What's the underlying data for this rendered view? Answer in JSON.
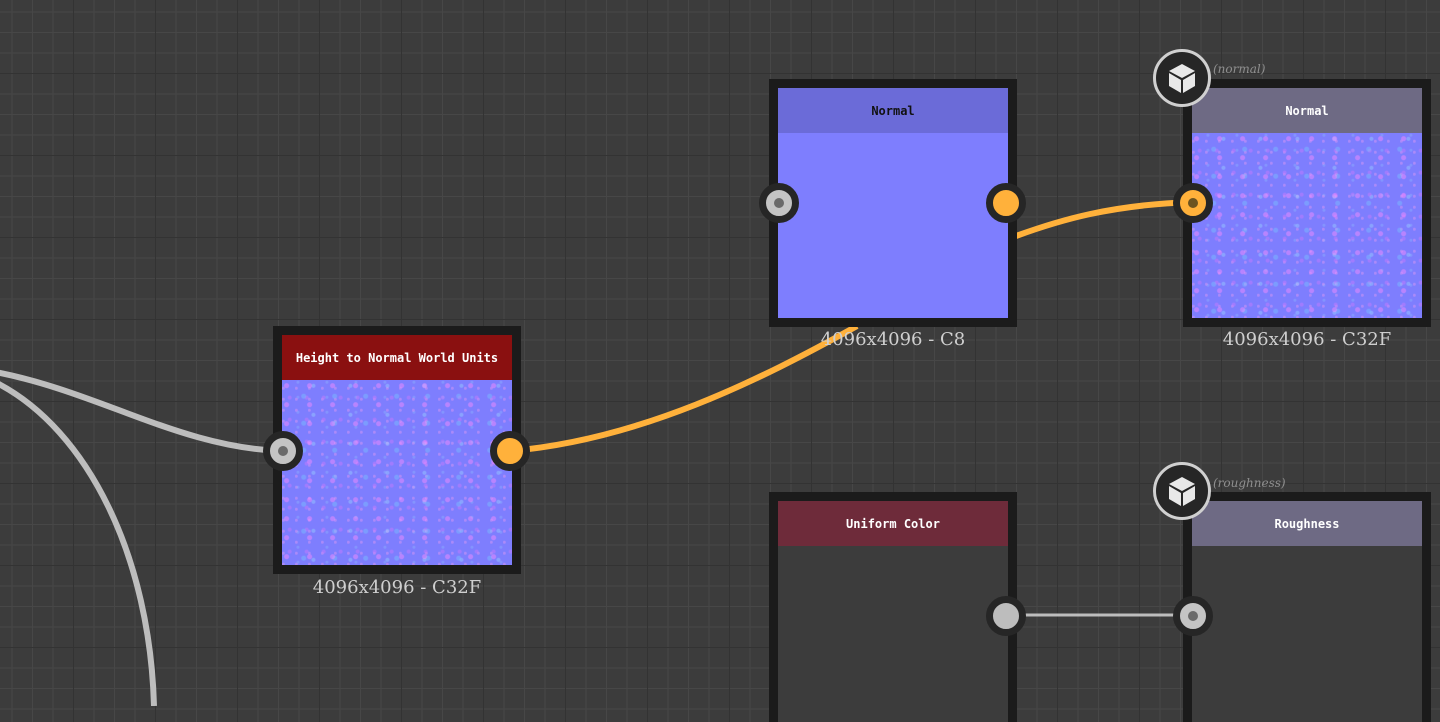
{
  "colors": {
    "wire_active": "#ffb13b",
    "wire_inactive": "#bdbdbd",
    "node_frame": "#1b1b1b",
    "normal_map": "#7e7efe"
  },
  "nodes": {
    "height_to_normal": {
      "title": "Height to Normal World Units",
      "resolution": "4096x4096 - C32F",
      "title_color": "#8a1010"
    },
    "normal": {
      "title": "Normal",
      "resolution": "4096x4096 - C8",
      "title_color": "#6b6bd8"
    },
    "normal_output": {
      "title": "Normal",
      "resolution": "4096x4096 - C32F",
      "title_color": "#6e6a84",
      "badge_caption": "(normal)",
      "badge_icon": "cube-icon"
    },
    "uniform_color": {
      "title": "Uniform Color",
      "title_color": "#6e2b3a"
    },
    "roughness_output": {
      "title": "Roughness",
      "title_color": "#6e6a84",
      "badge_caption": "(roughness)",
      "badge_icon": "cube-icon"
    }
  }
}
